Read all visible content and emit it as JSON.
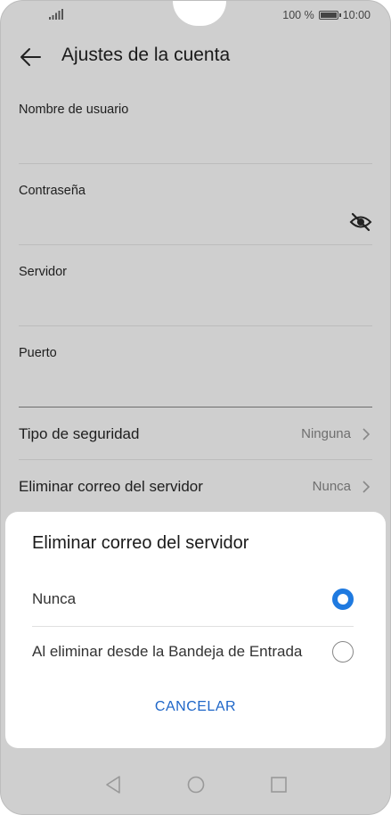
{
  "status_bar": {
    "battery_text": "100 %",
    "time": "10:00"
  },
  "app_bar": {
    "title": "Ajustes de la cuenta",
    "back_icon": "arrow-left-icon"
  },
  "form": {
    "username_label": "Nombre de usuario",
    "password_label": "Contraseña",
    "server_label": "Servidor",
    "port_label": "Puerto"
  },
  "settings": [
    {
      "label": "Tipo de seguridad",
      "value": "Ninguna"
    },
    {
      "label": "Eliminar correo del servidor",
      "value": "Nunca"
    }
  ],
  "dialog": {
    "title": "Eliminar correo del servidor",
    "options": [
      {
        "label": "Nunca",
        "selected": true
      },
      {
        "label": "Al eliminar desde la Bandeja de Entrada",
        "selected": false
      }
    ],
    "cancel_label": "CANCELAR"
  },
  "colors": {
    "accent": "#1f7ae0",
    "link": "#1e66c8",
    "overlay": "#cfcfcf"
  }
}
